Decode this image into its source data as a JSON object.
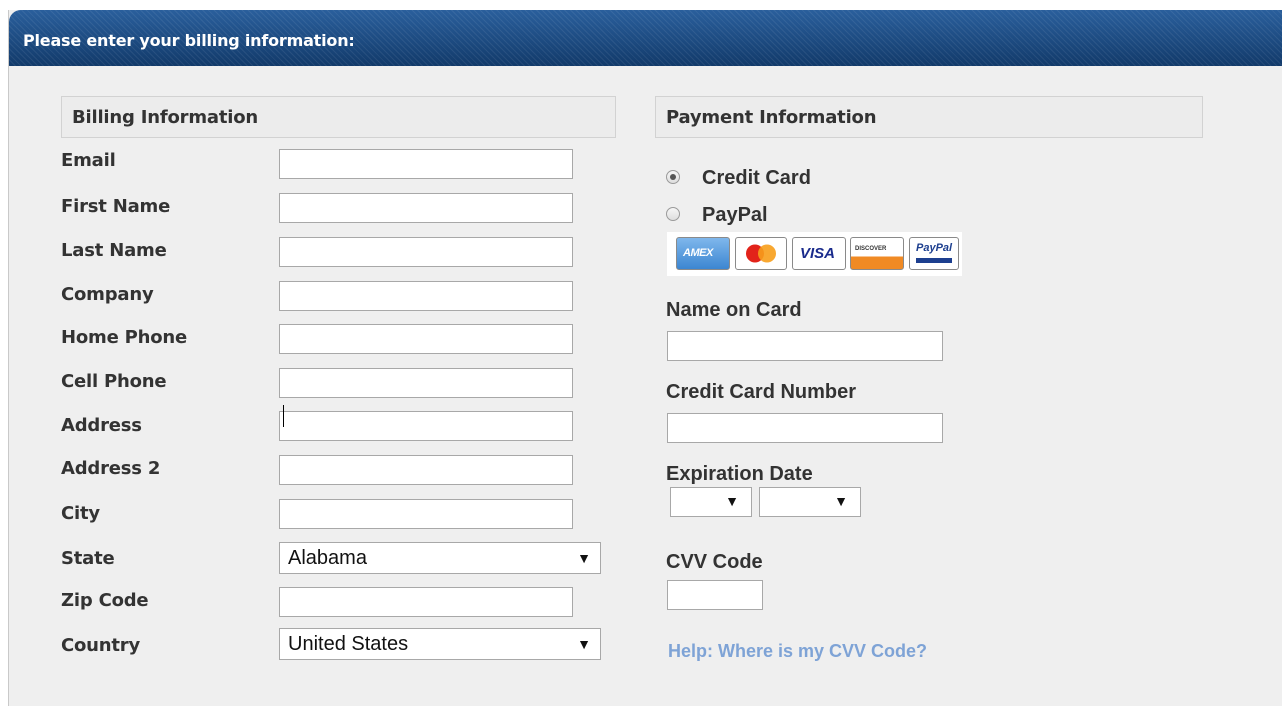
{
  "header": {
    "title": "Please enter your billing information:"
  },
  "billing": {
    "heading": "Billing Information",
    "fields": [
      {
        "label": "Email",
        "value": ""
      },
      {
        "label": "First Name",
        "value": ""
      },
      {
        "label": "Last Name",
        "value": ""
      },
      {
        "label": "Company",
        "value": ""
      },
      {
        "label": "Home Phone",
        "value": ""
      },
      {
        "label": "Cell Phone",
        "value": ""
      },
      {
        "label": "Address",
        "value": ""
      },
      {
        "label": "Address 2",
        "value": ""
      },
      {
        "label": "City",
        "value": ""
      },
      {
        "label": "State",
        "value": "Alabama"
      },
      {
        "label": "Zip Code",
        "value": ""
      },
      {
        "label": "Country",
        "value": "United States"
      }
    ]
  },
  "payment": {
    "heading": "Payment Information",
    "methods": [
      {
        "label": "Credit Card",
        "selected": true
      },
      {
        "label": "PayPal",
        "selected": false
      }
    ],
    "card_logos": [
      {
        "name": "amex-logo",
        "text": "AMEX"
      },
      {
        "name": "mastercard-logo",
        "text": ""
      },
      {
        "name": "visa-logo",
        "text": "VISA"
      },
      {
        "name": "discover-logo",
        "text": "DISCOVER"
      },
      {
        "name": "paypal-logo",
        "text": "PayPal"
      }
    ],
    "name_on_card_label": "Name on Card",
    "card_number_label": "Credit Card Number",
    "expiration_label": "Expiration Date",
    "exp_month": "",
    "exp_year": "",
    "cvv_label": "CVV Code",
    "help_link": "Help: Where is my CVV Code?"
  },
  "colors": {
    "header_blue": "#1f4f86",
    "panel_bg": "#efefef",
    "link": "#7ea3d6"
  }
}
